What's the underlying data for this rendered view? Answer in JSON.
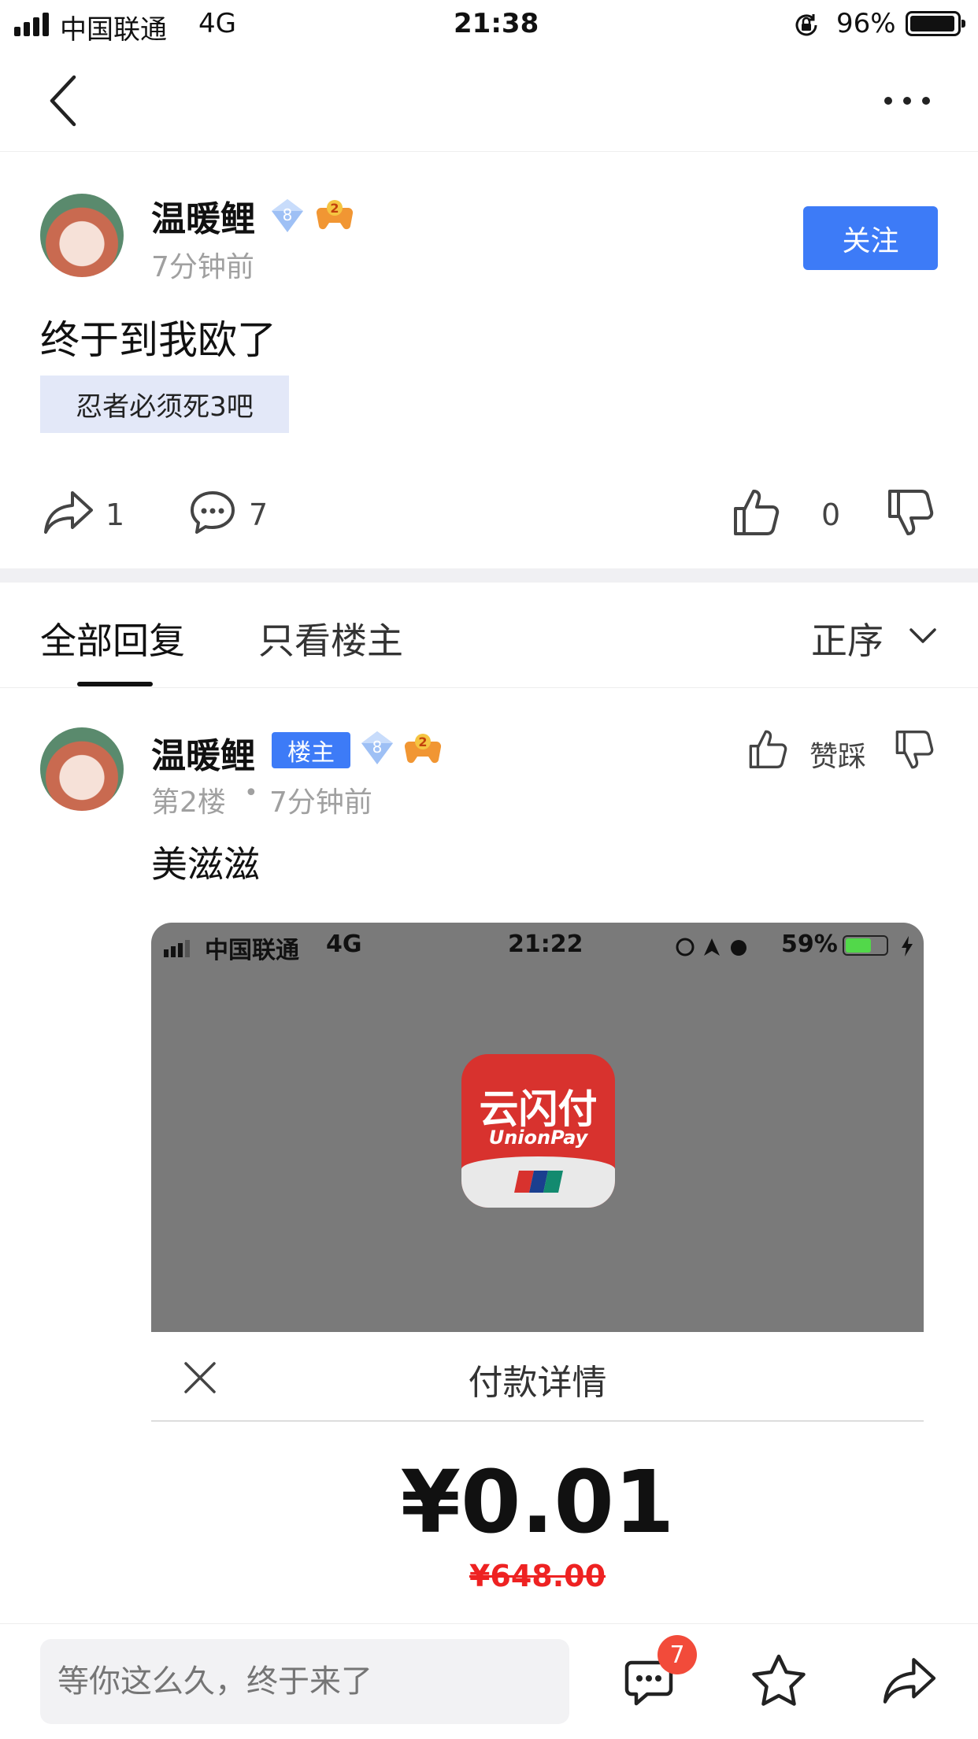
{
  "status_bar": {
    "carrier": "中国联通",
    "network": "4G",
    "time": "21:38",
    "battery": "96%"
  },
  "post": {
    "author": "温暖鲤",
    "level_badge": "8",
    "fan_badge": "2",
    "time": "7分钟前",
    "follow_label": "关注",
    "title": "终于到我欧了",
    "tag": "忍者必须死3吧",
    "share_count": "1",
    "comment_count": "7",
    "like_count": "0"
  },
  "tabs": {
    "all": "全部回复",
    "op_only": "只看楼主",
    "sort": "正序"
  },
  "reply": {
    "author": "温暖鲤",
    "op_badge": "楼主",
    "level_badge": "8",
    "fan_badge": "2",
    "floor": "第2楼",
    "separator": "•",
    "time": "7分钟前",
    "vote_label": "赞踩",
    "text": "美滋滋"
  },
  "embedded_screenshot": {
    "carrier": "中国联通",
    "network": "4G",
    "time": "21:22",
    "battery": "59%",
    "app_name": "云闪付",
    "app_name_en": "UnionPay",
    "pay_title": "付款详情",
    "amount": "¥0.01",
    "original_price": "¥648.00"
  },
  "bottom_bar": {
    "reply_placeholder": "等你这么久，终于来了",
    "message_badge": "7"
  },
  "colors": {
    "accent": "#3d7bf7",
    "badge_red": "#f24b3a",
    "tag_bg": "#e3e8f8"
  }
}
